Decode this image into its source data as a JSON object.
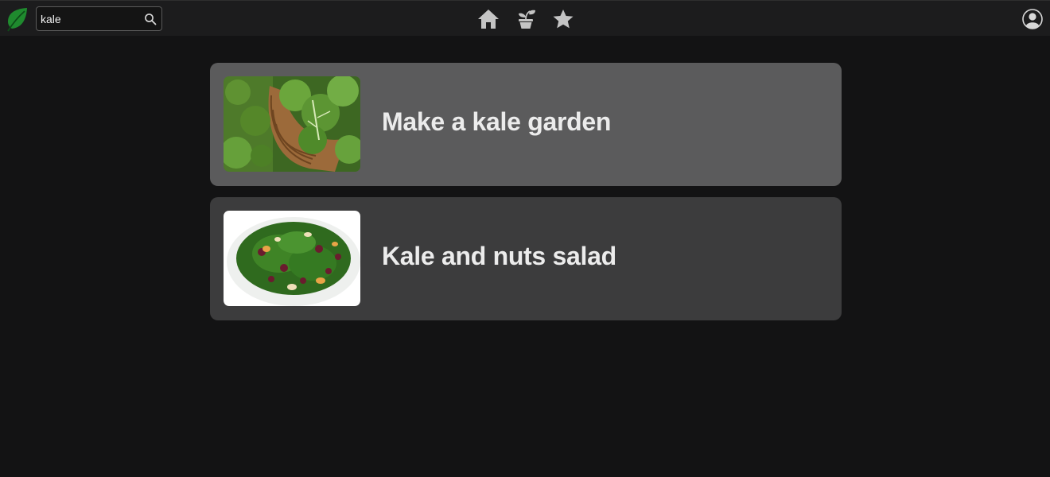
{
  "search": {
    "value": "kale"
  },
  "nav": {
    "icons": [
      "home-icon",
      "plant-icon",
      "star-icon"
    ]
  },
  "results": [
    {
      "title": "Make a kale garden"
    },
    {
      "title": "Kale and nuts salad"
    }
  ],
  "colors": {
    "background": "#131314",
    "topbar": "#1c1c1d",
    "card_highlight": "#5b5b5c",
    "card": "#3c3c3d",
    "logo_green": "#1f8a2e",
    "icon_gray": "#c4c4c4"
  }
}
